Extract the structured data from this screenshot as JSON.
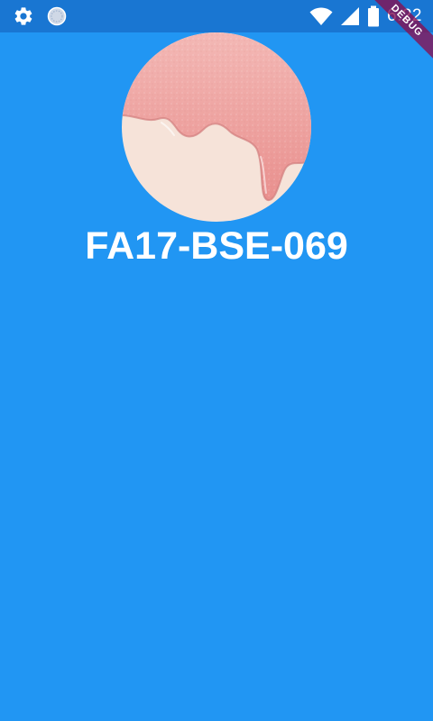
{
  "status_bar": {
    "time": "6:22",
    "icons_left": [
      "settings-gear-icon",
      "sync-indicator-icon"
    ],
    "icons_right": [
      "wifi-icon",
      "signal-icon",
      "battery-icon"
    ],
    "background": "#1976D2"
  },
  "debug_banner": {
    "label": "DEBUG",
    "color": "#880E4F"
  },
  "profile": {
    "name": "FA17-BSE-069",
    "avatar_colors": {
      "cream": "#F6E3D9",
      "pink": "#EFA2A0"
    }
  },
  "theme": {
    "background": "#2196F3",
    "text": "#FFFFFF"
  }
}
